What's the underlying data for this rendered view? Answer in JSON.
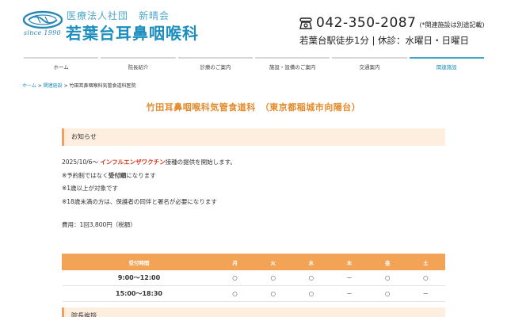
{
  "header": {
    "logo_since": "since 1990",
    "corporation": "医療法人社団　新晴会",
    "clinic_name": "若葉台耳鼻咽喉科",
    "tel_number": "042-350-2087",
    "tel_note": "(*関連施設は別途記載)",
    "access_info": "若葉台駅徒歩1分 | 休診：水曜日・日曜日",
    "brand_color": "#1d8fbe"
  },
  "nav": {
    "items": [
      {
        "label": "ホーム"
      },
      {
        "label": "院長紹介"
      },
      {
        "label": "診療のご案内"
      },
      {
        "label": "施設・設備のご案内"
      },
      {
        "label": "交通案内"
      },
      {
        "label": "関連施設",
        "active": true
      }
    ]
  },
  "breadcrumb": {
    "home": "ホーム",
    "sep1": " > ",
    "related": "関連施設",
    "sep2": " > ",
    "current": "竹田耳鼻咽喉科気管食道科医院"
  },
  "page": {
    "title": "竹田耳鼻咽喉科気管食道科　（東京都稲城市向陽台）",
    "title_color": "#e58a2a"
  },
  "notice": {
    "heading": "お知らせ",
    "line1_date": "2025/10/6〜 ",
    "line1_highlight": "インフルエンザワクチン",
    "line1_rest": "接種の提供を開始します。",
    "line2_pre": "※予約制ではなく",
    "line2_bold": "受付順",
    "line2_post": "になります",
    "line3": "※1歳以上が対象です",
    "line4": "※18歳未満の方は、保護者の同伴と署名が必要になります",
    "fee": "費用：1回3,800円（税額）"
  },
  "hours": {
    "headers": [
      "受付時間",
      "月",
      "火",
      "水",
      "木",
      "金",
      "土"
    ],
    "rows": [
      {
        "time": "9:00〜12:00",
        "marks": [
          "○",
          "○",
          "○",
          "－",
          "○",
          "○"
        ]
      },
      {
        "time": "15:00〜18:30",
        "marks": [
          "○",
          "○",
          "○",
          "－",
          "○",
          "－"
        ]
      }
    ]
  },
  "next_section": {
    "heading": "院長挨拶"
  }
}
